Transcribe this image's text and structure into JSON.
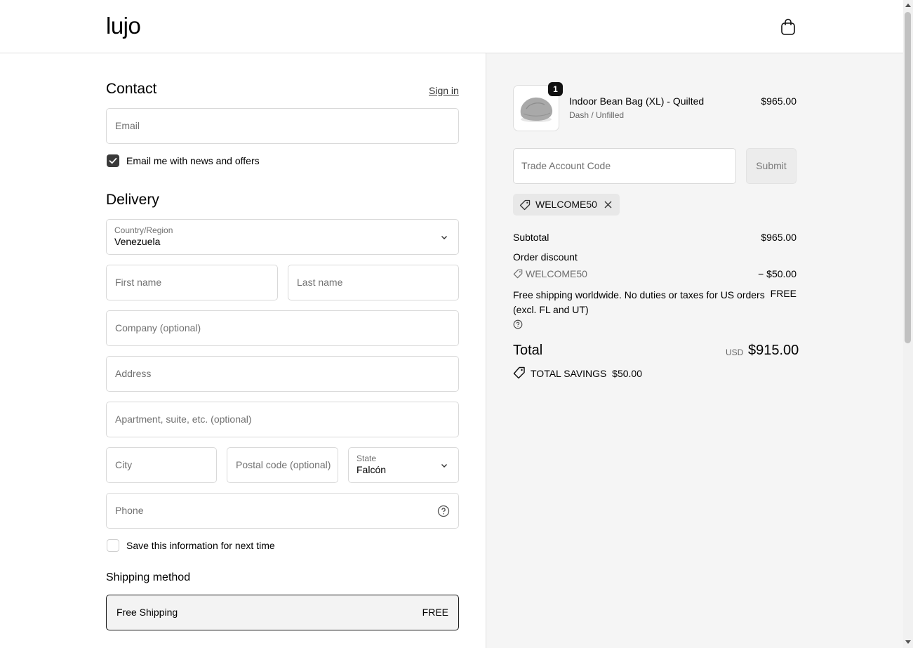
{
  "header": {
    "logo": "lujo",
    "cart_icon": "shopping-bag-icon"
  },
  "contact": {
    "title": "Contact",
    "sign_in": "Sign in",
    "email_placeholder": "Email",
    "newsletter_label": "Email me with news and offers",
    "newsletter_checked": true
  },
  "delivery": {
    "title": "Delivery",
    "country_label": "Country/Region",
    "country_value": "Venezuela",
    "first_name_placeholder": "First name",
    "last_name_placeholder": "Last name",
    "company_placeholder": "Company (optional)",
    "address_placeholder": "Address",
    "apartment_placeholder": "Apartment, suite, etc. (optional)",
    "city_placeholder": "City",
    "postal_placeholder": "Postal code (optional)",
    "state_label": "State",
    "state_value": "Falcón",
    "phone_placeholder": "Phone",
    "save_info_label": "Save this information for next time",
    "save_info_checked": false
  },
  "shipping": {
    "title": "Shipping method",
    "option_name": "Free Shipping",
    "option_price": "FREE"
  },
  "summary": {
    "item": {
      "quantity": "1",
      "name": "Indoor Bean Bag (XL) - Quilted",
      "variant": "Dash / Unfilled",
      "price": "$965.00"
    },
    "trade_code_placeholder": "Trade Account Code",
    "submit_label": "Submit",
    "applied_code": "WELCOME50",
    "subtotal_label": "Subtotal",
    "subtotal_value": "$965.00",
    "discount_label": "Order discount",
    "discount_code": "WELCOME50",
    "discount_value": "− $50.00",
    "shipping_text": "Free shipping worldwide. No duties or taxes for US orders (excl. FL and UT)",
    "shipping_value": "FREE",
    "total_label": "Total",
    "total_currency": "USD",
    "total_value": "$915.00",
    "savings_text": "TOTAL SAVINGS  $50.00"
  }
}
